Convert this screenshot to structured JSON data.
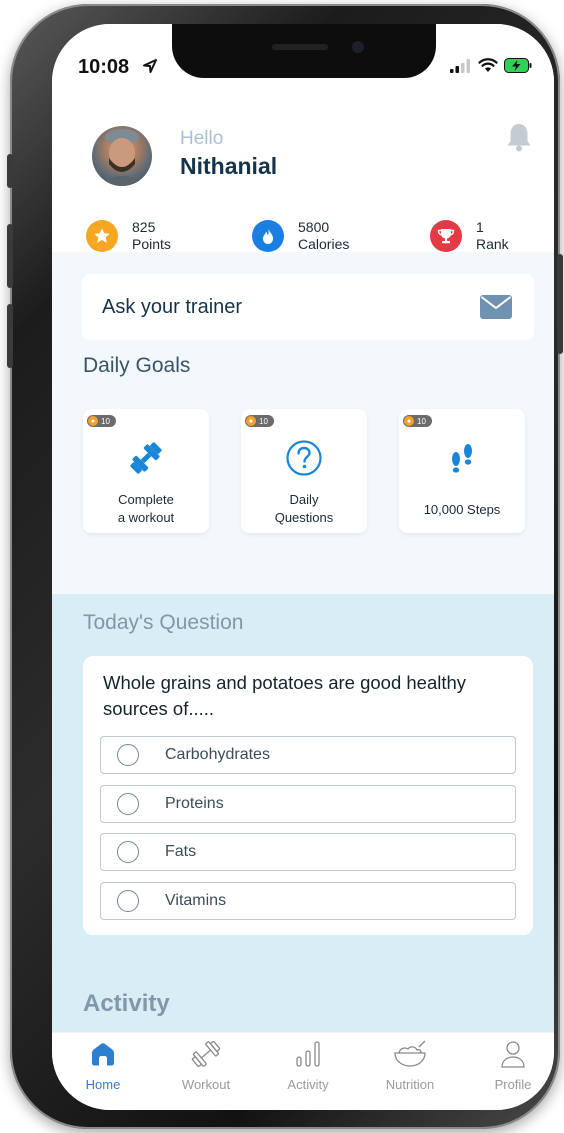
{
  "status_bar": {
    "time": "10:08"
  },
  "header": {
    "greeting": "Hello",
    "name": "Nithanial"
  },
  "stats": [
    {
      "value": "825",
      "label": "Points",
      "icon": "star-icon",
      "color": "#f5a623"
    },
    {
      "value": "5800",
      "label": "Calories",
      "icon": "flame-icon",
      "color": "#1b7fe0"
    },
    {
      "value": "1",
      "label": "Rank",
      "icon": "trophy-icon",
      "color": "#e53945"
    }
  ],
  "trainer": {
    "label": "Ask your trainer",
    "icon": "mail-icon"
  },
  "daily_goals": {
    "title": "Daily Goals",
    "items": [
      {
        "badge": "10",
        "label_line1": "Complete",
        "label_line2": "a workout",
        "icon": "dumbbell-icon"
      },
      {
        "badge": "10",
        "label_line1": "Daily",
        "label_line2": "Questions",
        "icon": "question-icon"
      },
      {
        "badge": "10",
        "label_line1": "10,000 Steps",
        "label_line2": "",
        "icon": "footsteps-icon"
      }
    ]
  },
  "question": {
    "title": "Today's Question",
    "text": "Whole grains and potatoes are good healthy sources of.....",
    "options": [
      "Carbohydrates",
      "Proteins",
      "Fats",
      "Vitamins"
    ]
  },
  "activity": {
    "title": "Activity"
  },
  "tabs": [
    {
      "label": "Home",
      "icon": "home-icon",
      "active": true
    },
    {
      "label": "Workout",
      "icon": "dumbbell-icon",
      "active": false
    },
    {
      "label": "Activity",
      "icon": "bar-chart-icon",
      "active": false
    },
    {
      "label": "Nutrition",
      "icon": "bowl-icon",
      "active": false
    },
    {
      "label": "Profile",
      "icon": "person-icon",
      "active": false
    }
  ],
  "colors": {
    "accent": "#2f7fd0",
    "title": "#14344a",
    "section_bg": "#d9edf4"
  }
}
